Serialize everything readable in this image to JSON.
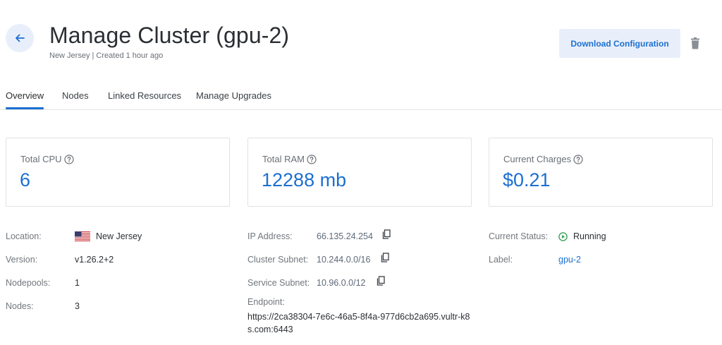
{
  "header": {
    "title": "Manage Cluster (gpu-2)",
    "subtitle": "New Jersey | Created 1 hour ago",
    "download_label": "Download Configuration"
  },
  "tabs": [
    {
      "label": "Overview",
      "active": true
    },
    {
      "label": "Nodes",
      "active": false
    },
    {
      "label": "Linked Resources",
      "active": false
    },
    {
      "label": "Manage Upgrades",
      "active": false
    }
  ],
  "cards": [
    {
      "label": "Total CPU",
      "value": "6"
    },
    {
      "label": "Total RAM",
      "value": "12288 mb"
    },
    {
      "label": "Current Charges",
      "value": "$0.21"
    }
  ],
  "details": {
    "location": {
      "label": "Location:",
      "value": "New Jersey"
    },
    "version": {
      "label": "Version:",
      "value": "v1.26.2+2"
    },
    "nodepools": {
      "label": "Nodepools:",
      "value": "1"
    },
    "nodes": {
      "label": "Nodes:",
      "value": "3"
    },
    "ip_address": {
      "label": "IP Address:",
      "value": "66.135.24.254"
    },
    "cluster_subnet": {
      "label": "Cluster Subnet:",
      "value": "10.244.0.0/16"
    },
    "service_subnet": {
      "label": "Service Subnet:",
      "value": "10.96.0.0/12"
    },
    "endpoint": {
      "label": "Endpoint:",
      "value": "https://2ca38304-7e6c-46a5-8f4a-977d6cb2a695.vultr-k8s.com:6443"
    },
    "status": {
      "label": "Current Status:",
      "value": "Running"
    },
    "label": {
      "label": "Label:",
      "value": "gpu-2"
    }
  },
  "colors": {
    "accent": "#1c6fd1",
    "status_running": "#2e9e4f"
  },
  "icons": [
    "back-arrow-icon",
    "trash-icon",
    "help-icon",
    "us-flag-icon",
    "copy-icon",
    "play-circle-icon"
  ]
}
